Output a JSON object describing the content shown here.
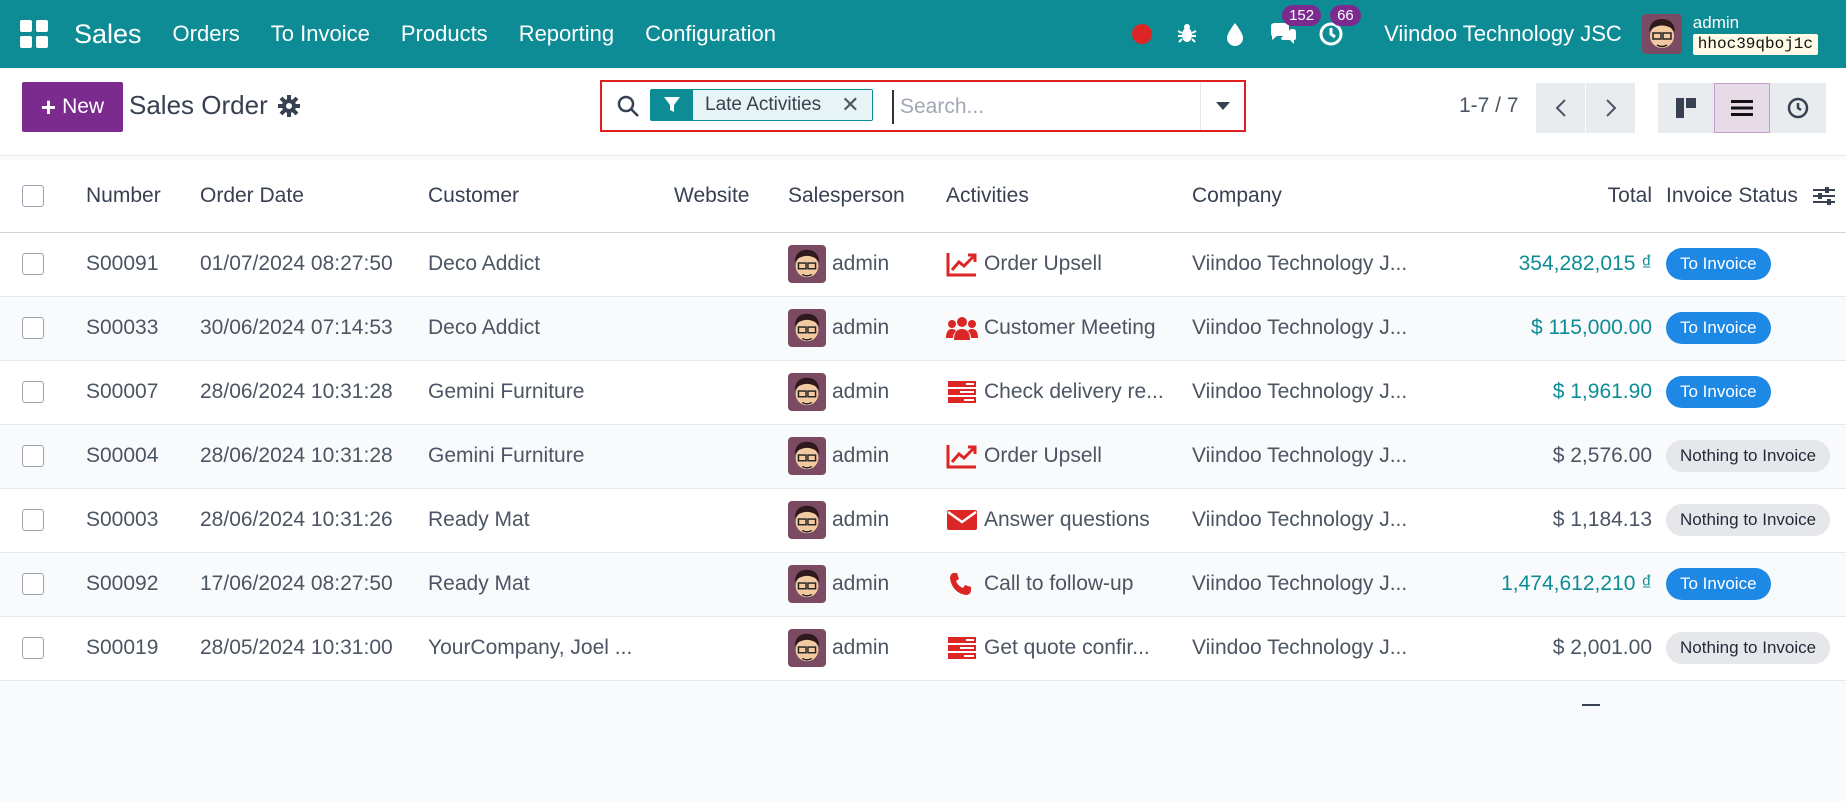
{
  "nav": {
    "app_title": "Sales",
    "menu": [
      "Orders",
      "To Invoice",
      "Products",
      "Reporting",
      "Configuration"
    ],
    "messages_count": "152",
    "activities_count": "66",
    "company": "Viindoo Technology JSC",
    "user_name": "admin",
    "db_name": "hhoc39qboj1c",
    "colors": {
      "bar": "#0e8c96",
      "badge": "#7b2b8e",
      "record": "#dc2626"
    }
  },
  "control": {
    "new_label": "New",
    "title": "Sales Order",
    "search": {
      "facet_label": "Late Activities",
      "placeholder": "Search..."
    },
    "pager": "1-7 / 7"
  },
  "table": {
    "columns": [
      "Number",
      "Order Date",
      "Customer",
      "Website",
      "Salesperson",
      "Activities",
      "Company",
      "Total",
      "Invoice Status"
    ],
    "rows": [
      {
        "number": "S00091",
        "date": "01/07/2024 08:27:50",
        "customer": "Deco Addict",
        "website": "",
        "salesperson": "admin",
        "activity_icon": "chart-line-icon",
        "activity": "Order Upsell",
        "company": "Viindoo Technology J...",
        "total": "354,282,015 ₫",
        "total_link": true,
        "status": "To Invoice",
        "status_type": "blue"
      },
      {
        "number": "S00033",
        "date": "30/06/2024 07:14:53",
        "customer": "Deco Addict",
        "website": "",
        "salesperson": "admin",
        "activity_icon": "users-icon",
        "activity": "Customer Meeting",
        "company": "Viindoo Technology J...",
        "total": "$ 115,000.00",
        "total_link": true,
        "status": "To Invoice",
        "status_type": "blue"
      },
      {
        "number": "S00007",
        "date": "28/06/2024 10:31:28",
        "customer": "Gemini Furniture",
        "website": "",
        "salesperson": "admin",
        "activity_icon": "tasks-icon",
        "activity": "Check delivery re...",
        "company": "Viindoo Technology J...",
        "total": "$ 1,961.90",
        "total_link": true,
        "status": "To Invoice",
        "status_type": "blue"
      },
      {
        "number": "S00004",
        "date": "28/06/2024 10:31:28",
        "customer": "Gemini Furniture",
        "website": "",
        "salesperson": "admin",
        "activity_icon": "chart-line-icon",
        "activity": "Order Upsell",
        "company": "Viindoo Technology J...",
        "total": "$ 2,576.00",
        "total_link": false,
        "status": "Nothing to Invoice",
        "status_type": "grey"
      },
      {
        "number": "S00003",
        "date": "28/06/2024 10:31:26",
        "customer": "Ready Mat",
        "website": "",
        "salesperson": "admin",
        "activity_icon": "envelope-icon",
        "activity": "Answer questions",
        "company": "Viindoo Technology J...",
        "total": "$ 1,184.13",
        "total_link": false,
        "status": "Nothing to Invoice",
        "status_type": "grey"
      },
      {
        "number": "S00092",
        "date": "17/06/2024 08:27:50",
        "customer": "Ready Mat",
        "website": "",
        "salesperson": "admin",
        "activity_icon": "phone-icon",
        "activity": "Call to follow-up",
        "company": "Viindoo Technology J...",
        "total": "1,474,612,210 ₫",
        "total_link": true,
        "status": "To Invoice",
        "status_type": "blue"
      },
      {
        "number": "S00019",
        "date": "28/05/2024 10:31:00",
        "customer": "YourCompany, Joel ...",
        "website": "",
        "salesperson": "admin",
        "activity_icon": "tasks-icon",
        "activity": "Get quote confir...",
        "company": "Viindoo Technology J...",
        "total": "$ 2,001.00",
        "total_link": false,
        "status": "Nothing to Invoice",
        "status_type": "grey"
      }
    ]
  }
}
